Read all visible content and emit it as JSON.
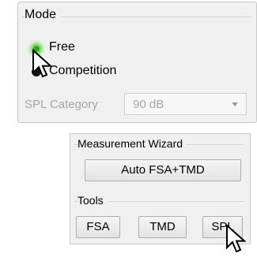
{
  "mode": {
    "title": "Mode",
    "options": [
      {
        "label": "Free",
        "selected": true
      },
      {
        "label": "Competition",
        "selected": false
      }
    ],
    "spl_category": {
      "label": "SPL Category",
      "value": "90 dB",
      "enabled": false
    }
  },
  "measurement_wizard": {
    "title": "Measurement Wizard",
    "button_label": "Auto FSA+TMD"
  },
  "tools": {
    "title": "Tools",
    "buttons": [
      "FSA",
      "TMD",
      "SPL"
    ]
  },
  "colors": {
    "radio_active": "#2fa52a",
    "panel_bg": "#f0f0f0",
    "disabled_text": "#a6a6a6"
  }
}
